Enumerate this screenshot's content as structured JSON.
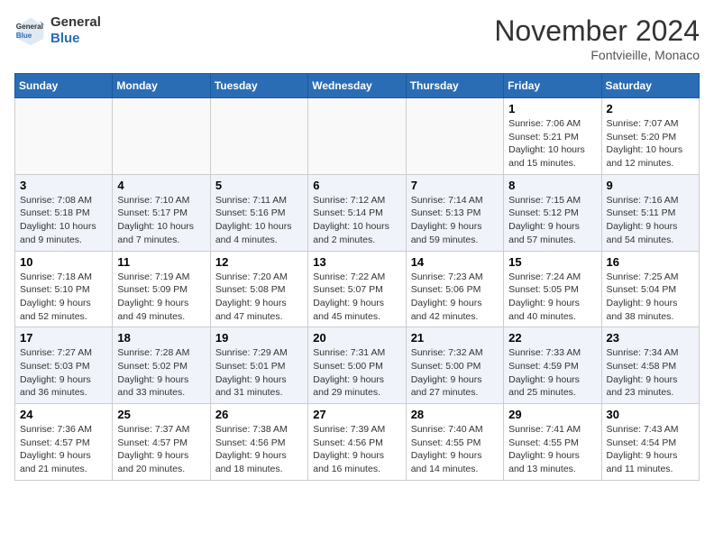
{
  "header": {
    "logo_general": "General",
    "logo_blue": "Blue",
    "month": "November 2024",
    "location": "Fontvieille, Monaco"
  },
  "days_of_week": [
    "Sunday",
    "Monday",
    "Tuesday",
    "Wednesday",
    "Thursday",
    "Friday",
    "Saturday"
  ],
  "weeks": [
    [
      {
        "day": "",
        "info": ""
      },
      {
        "day": "",
        "info": ""
      },
      {
        "day": "",
        "info": ""
      },
      {
        "day": "",
        "info": ""
      },
      {
        "day": "",
        "info": ""
      },
      {
        "day": "1",
        "info": "Sunrise: 7:06 AM\nSunset: 5:21 PM\nDaylight: 10 hours and 15 minutes."
      },
      {
        "day": "2",
        "info": "Sunrise: 7:07 AM\nSunset: 5:20 PM\nDaylight: 10 hours and 12 minutes."
      }
    ],
    [
      {
        "day": "3",
        "info": "Sunrise: 7:08 AM\nSunset: 5:18 PM\nDaylight: 10 hours and 9 minutes."
      },
      {
        "day": "4",
        "info": "Sunrise: 7:10 AM\nSunset: 5:17 PM\nDaylight: 10 hours and 7 minutes."
      },
      {
        "day": "5",
        "info": "Sunrise: 7:11 AM\nSunset: 5:16 PM\nDaylight: 10 hours and 4 minutes."
      },
      {
        "day": "6",
        "info": "Sunrise: 7:12 AM\nSunset: 5:14 PM\nDaylight: 10 hours and 2 minutes."
      },
      {
        "day": "7",
        "info": "Sunrise: 7:14 AM\nSunset: 5:13 PM\nDaylight: 9 hours and 59 minutes."
      },
      {
        "day": "8",
        "info": "Sunrise: 7:15 AM\nSunset: 5:12 PM\nDaylight: 9 hours and 57 minutes."
      },
      {
        "day": "9",
        "info": "Sunrise: 7:16 AM\nSunset: 5:11 PM\nDaylight: 9 hours and 54 minutes."
      }
    ],
    [
      {
        "day": "10",
        "info": "Sunrise: 7:18 AM\nSunset: 5:10 PM\nDaylight: 9 hours and 52 minutes."
      },
      {
        "day": "11",
        "info": "Sunrise: 7:19 AM\nSunset: 5:09 PM\nDaylight: 9 hours and 49 minutes."
      },
      {
        "day": "12",
        "info": "Sunrise: 7:20 AM\nSunset: 5:08 PM\nDaylight: 9 hours and 47 minutes."
      },
      {
        "day": "13",
        "info": "Sunrise: 7:22 AM\nSunset: 5:07 PM\nDaylight: 9 hours and 45 minutes."
      },
      {
        "day": "14",
        "info": "Sunrise: 7:23 AM\nSunset: 5:06 PM\nDaylight: 9 hours and 42 minutes."
      },
      {
        "day": "15",
        "info": "Sunrise: 7:24 AM\nSunset: 5:05 PM\nDaylight: 9 hours and 40 minutes."
      },
      {
        "day": "16",
        "info": "Sunrise: 7:25 AM\nSunset: 5:04 PM\nDaylight: 9 hours and 38 minutes."
      }
    ],
    [
      {
        "day": "17",
        "info": "Sunrise: 7:27 AM\nSunset: 5:03 PM\nDaylight: 9 hours and 36 minutes."
      },
      {
        "day": "18",
        "info": "Sunrise: 7:28 AM\nSunset: 5:02 PM\nDaylight: 9 hours and 33 minutes."
      },
      {
        "day": "19",
        "info": "Sunrise: 7:29 AM\nSunset: 5:01 PM\nDaylight: 9 hours and 31 minutes."
      },
      {
        "day": "20",
        "info": "Sunrise: 7:31 AM\nSunset: 5:00 PM\nDaylight: 9 hours and 29 minutes."
      },
      {
        "day": "21",
        "info": "Sunrise: 7:32 AM\nSunset: 5:00 PM\nDaylight: 9 hours and 27 minutes."
      },
      {
        "day": "22",
        "info": "Sunrise: 7:33 AM\nSunset: 4:59 PM\nDaylight: 9 hours and 25 minutes."
      },
      {
        "day": "23",
        "info": "Sunrise: 7:34 AM\nSunset: 4:58 PM\nDaylight: 9 hours and 23 minutes."
      }
    ],
    [
      {
        "day": "24",
        "info": "Sunrise: 7:36 AM\nSunset: 4:57 PM\nDaylight: 9 hours and 21 minutes."
      },
      {
        "day": "25",
        "info": "Sunrise: 7:37 AM\nSunset: 4:57 PM\nDaylight: 9 hours and 20 minutes."
      },
      {
        "day": "26",
        "info": "Sunrise: 7:38 AM\nSunset: 4:56 PM\nDaylight: 9 hours and 18 minutes."
      },
      {
        "day": "27",
        "info": "Sunrise: 7:39 AM\nSunset: 4:56 PM\nDaylight: 9 hours and 16 minutes."
      },
      {
        "day": "28",
        "info": "Sunrise: 7:40 AM\nSunset: 4:55 PM\nDaylight: 9 hours and 14 minutes."
      },
      {
        "day": "29",
        "info": "Sunrise: 7:41 AM\nSunset: 4:55 PM\nDaylight: 9 hours and 13 minutes."
      },
      {
        "day": "30",
        "info": "Sunrise: 7:43 AM\nSunset: 4:54 PM\nDaylight: 9 hours and 11 minutes."
      }
    ]
  ]
}
